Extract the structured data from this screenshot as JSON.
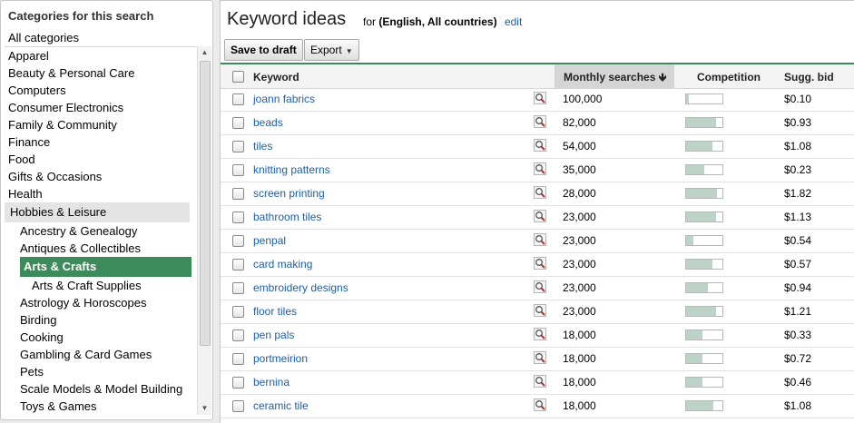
{
  "categories_panel": {
    "title": "Categories for this search",
    "all": "All categories",
    "items": [
      {
        "label": "Apparel",
        "level": 0
      },
      {
        "label": "Beauty & Personal Care",
        "level": 0
      },
      {
        "label": "Computers",
        "level": 0
      },
      {
        "label": "Consumer Electronics",
        "level": 0
      },
      {
        "label": "Family & Community",
        "level": 0
      },
      {
        "label": "Finance",
        "level": 0
      },
      {
        "label": "Food",
        "level": 0
      },
      {
        "label": "Gifts & Occasions",
        "level": 0
      },
      {
        "label": "Health",
        "level": 0
      },
      {
        "label": "Hobbies & Leisure",
        "level": 0,
        "state": "open"
      },
      {
        "label": "Ancestry & Genealogy",
        "level": 1
      },
      {
        "label": "Antiques & Collectibles",
        "level": 1
      },
      {
        "label": "Arts & Crafts",
        "level": 1,
        "state": "selected"
      },
      {
        "label": "Arts & Craft Supplies",
        "level": 2
      },
      {
        "label": "Astrology & Horoscopes",
        "level": 1
      },
      {
        "label": "Birding",
        "level": 1
      },
      {
        "label": "Cooking",
        "level": 1
      },
      {
        "label": "Gambling & Card Games",
        "level": 1
      },
      {
        "label": "Pets",
        "level": 1
      },
      {
        "label": "Scale Models & Model Building",
        "level": 1
      },
      {
        "label": "Toys & Games",
        "level": 1
      }
    ]
  },
  "main": {
    "title": "Keyword ideas",
    "for_prefix": "for",
    "for_value": "(English, All countries)",
    "edit_link": "edit",
    "toolbar": {
      "save_label": "Save to draft",
      "export_label": "Export"
    },
    "columns": {
      "keyword": "Keyword",
      "monthly": "Monthly searches",
      "sort_icon": "down-arrow-icon",
      "competition": "Competition",
      "bid": "Sugg. bid"
    },
    "colors": {
      "accent": "#3d8b5a",
      "link": "#1c5fa8",
      "competition_fill": "#bdd3c8"
    },
    "rows": [
      {
        "keyword": "joann fabrics",
        "monthly": "100,000",
        "competition": 0.08,
        "bid": "$0.10"
      },
      {
        "keyword": "beads",
        "monthly": "82,000",
        "competition": 0.82,
        "bid": "$0.93"
      },
      {
        "keyword": "tiles",
        "monthly": "54,000",
        "competition": 0.72,
        "bid": "$1.08"
      },
      {
        "keyword": "knitting patterns",
        "monthly": "35,000",
        "competition": 0.5,
        "bid": "$0.23"
      },
      {
        "keyword": "screen printing",
        "monthly": "28,000",
        "competition": 0.85,
        "bid": "$1.82"
      },
      {
        "keyword": "bathroom tiles",
        "monthly": "23,000",
        "competition": 0.82,
        "bid": "$1.13"
      },
      {
        "keyword": "penpal",
        "monthly": "23,000",
        "competition": 0.2,
        "bid": "$0.54"
      },
      {
        "keyword": "card making",
        "monthly": "23,000",
        "competition": 0.72,
        "bid": "$0.57"
      },
      {
        "keyword": "embroidery designs",
        "monthly": "23,000",
        "competition": 0.6,
        "bid": "$0.94"
      },
      {
        "keyword": "floor tiles",
        "monthly": "23,000",
        "competition": 0.82,
        "bid": "$1.21"
      },
      {
        "keyword": "pen pals",
        "monthly": "18,000",
        "competition": 0.45,
        "bid": "$0.33"
      },
      {
        "keyword": "portmeirion",
        "monthly": "18,000",
        "competition": 0.45,
        "bid": "$0.72"
      },
      {
        "keyword": "bernina",
        "monthly": "18,000",
        "competition": 0.45,
        "bid": "$0.46"
      },
      {
        "keyword": "ceramic tile",
        "monthly": "18,000",
        "competition": 0.75,
        "bid": "$1.08"
      }
    ]
  }
}
